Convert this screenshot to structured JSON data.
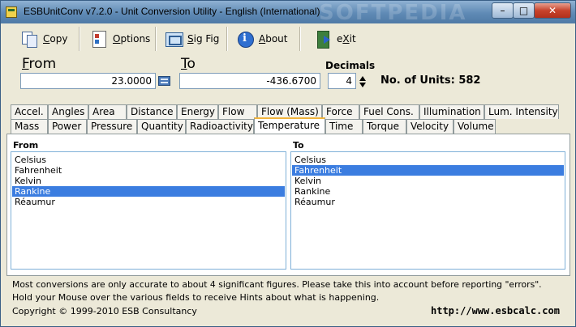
{
  "window": {
    "title": "ESBUnitConv v7.2.0 - Unit Conversion Utility - English (International)",
    "watermark": "SOFTPEDIA",
    "controls": {
      "minimize": "–",
      "maximize": "□",
      "close": "✕"
    }
  },
  "toolbar": {
    "copy": {
      "label_u": "C",
      "label_rest": "opy"
    },
    "options": {
      "label_u": "O",
      "label_rest": "ptions"
    },
    "sigfig": {
      "label_u": "S",
      "label_rest": "ig Fig"
    },
    "about": {
      "label_u": "A",
      "label_rest": "bout"
    },
    "exit": {
      "label_pre": "e",
      "label_u": "X",
      "label_rest": "it"
    }
  },
  "conversion": {
    "from_label_u": "F",
    "from_label_rest": "rom",
    "to_label_u": "T",
    "to_label_rest": "o",
    "from_value": "23.0000",
    "to_value": "-436.6700",
    "decimals_label": "Decimals",
    "decimals_value": "4",
    "units_count": "No. of Units: 582"
  },
  "tabs_row1": [
    "Accel.",
    "Angles",
    "Area",
    "Distance",
    "Energy",
    "Flow",
    "Flow (Mass)",
    "Force",
    "Fuel Cons.",
    "Illumination",
    "Lum. Intensity"
  ],
  "tabs_row2": [
    "Mass",
    "Power",
    "Pressure",
    "Quantity",
    "Radioactivity",
    "Temperature",
    "Time",
    "Torque",
    "Velocity",
    "Volume"
  ],
  "active_tab": "Temperature",
  "from_list": {
    "label": "From",
    "items": [
      "Celsius",
      "Fahrenheit",
      "Kelvin",
      "Rankine",
      "Réaumur"
    ],
    "selected": "Rankine"
  },
  "to_list": {
    "label": "To",
    "items": [
      "Celsius",
      "Fahrenheit",
      "Kelvin",
      "Rankine",
      "Réaumur"
    ],
    "selected": "Fahrenheit"
  },
  "status": {
    "line1": "Most conversions are only accurate to about 4 significant figures. Please take this into account before reporting \"errors\".",
    "line2": "Hold your Mouse over the various fields to receive Hints about what is happening.",
    "copyright": "Copyright © 1999-2010 ESB Consultancy",
    "url": "http://www.esbcalc.com"
  }
}
